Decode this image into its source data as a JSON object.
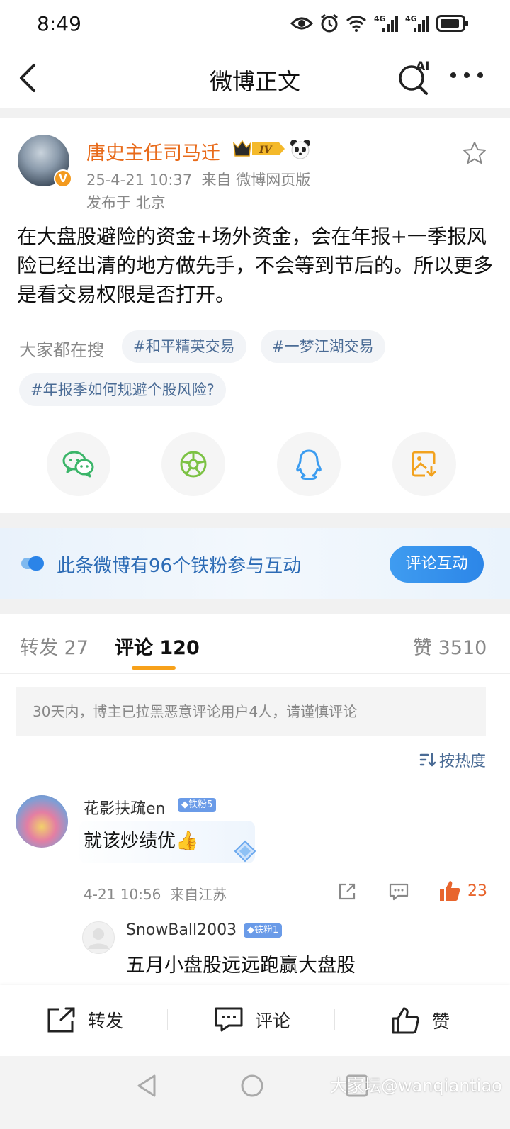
{
  "status_bar": {
    "time": "8:49",
    "icons": [
      "eye-icon",
      "alarm-icon",
      "wifi-icon",
      "signal-4g-icon",
      "signal-4g-icon",
      "battery-icon"
    ],
    "network_labels": [
      "4G",
      "4G"
    ]
  },
  "header": {
    "title": "微博正文",
    "ai_label": "AI"
  },
  "post": {
    "username": "唐史主任司马迁",
    "level_badge": "IV",
    "verified_mark": "V",
    "timestamp": "25-4-21 10:37",
    "source": "来自 微博网页版",
    "location": "发布于 北京",
    "text": "在大盘股避险的资金+场外资金，会在年报+一季报风险已经出清的地方做先手，不会等到节后的。所以更多是看交易权限是否打开。"
  },
  "search": {
    "label": "大家都在搜",
    "tags": [
      "#和平精英交易",
      "#一梦江湖交易",
      "#年报季如何规避个股风险?"
    ]
  },
  "share_icons": [
    "wechat-icon",
    "moments-icon",
    "qq-icon",
    "save-image-icon"
  ],
  "fan_banner": {
    "text": "此条微博有96个铁粉参与互动",
    "button": "评论互动"
  },
  "tabs": {
    "repost": "转发 27",
    "comments": "评论 120",
    "likes": "赞 3510",
    "active": "comments"
  },
  "notice": "30天内，博主已拉黑恶意评论用户4人，请谨慎评论",
  "sort": "按热度",
  "comment": {
    "username": "花影扶疏en",
    "fan_badge": "铁粉5",
    "text": "就该炒绩优👍",
    "time": "4-21 10:56",
    "location": "来自江苏",
    "like_count": "23"
  },
  "reply": {
    "username": "SnowBall2003",
    "fan_badge": "铁粉1",
    "text": "五月小盘股远远跑赢大盘股"
  },
  "action_bar": {
    "repost": "转发",
    "comment": "评论",
    "like": "赞"
  },
  "watermark": "大家坛@wanqiantiao",
  "colors": {
    "username": "#e86b1b",
    "link": "#4a6b95",
    "tab_indicator": "#f7a11a",
    "like": "#e8652d",
    "banner_button": "#2c86e8"
  }
}
